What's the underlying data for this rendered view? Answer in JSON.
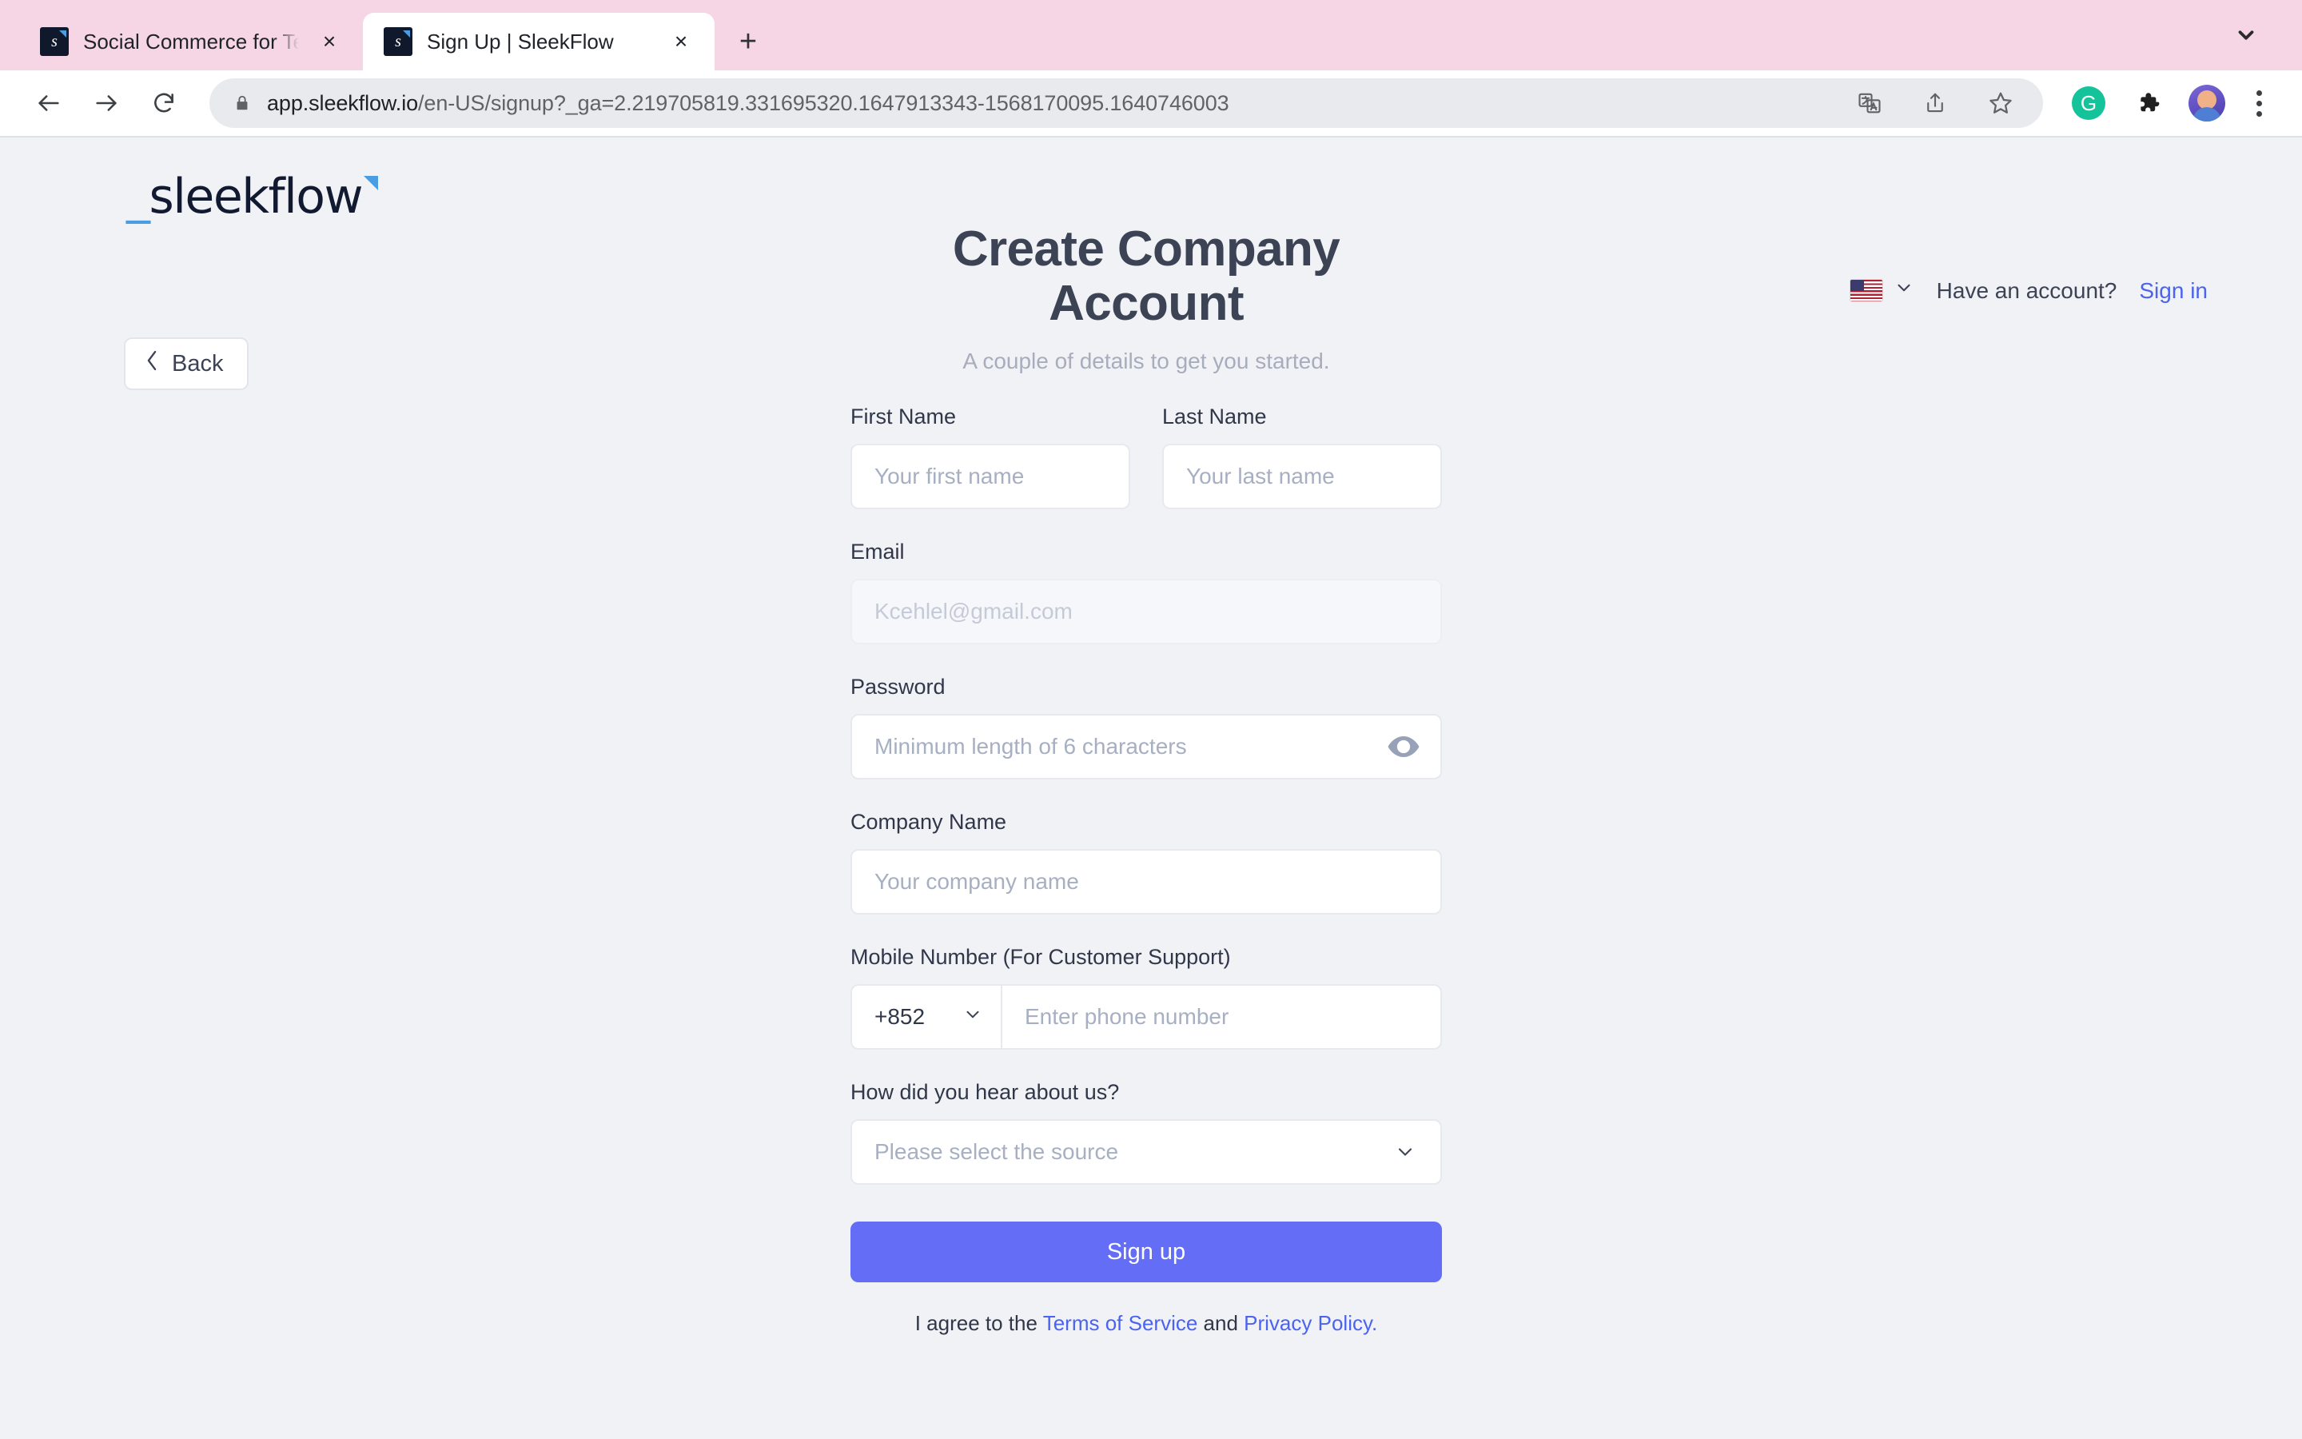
{
  "browser": {
    "tabs": [
      {
        "title": "Social Commerce for Teams | S",
        "favicon": "sleekflow-favicon",
        "active": false
      },
      {
        "title": "Sign Up | SleekFlow",
        "favicon": "sleekflow-favicon",
        "active": true
      }
    ],
    "new_tab_label": "+",
    "close_label": "×",
    "nav": {
      "back": "←",
      "forward": "→",
      "reload": "⟳"
    },
    "omnibox": {
      "url_bold": "app.sleekflow.io",
      "url_dim": "/en-US/signup?_ga=2.219705819.331695320.1647913343-1568170095.1640746003",
      "lock_icon": "lock-icon",
      "icons": [
        "translate-icon",
        "share-icon",
        "bookmark-star-icon"
      ]
    },
    "extensions": [
      "grammarly-icon",
      "puzzle-extensions-icon",
      "profile-avatar",
      "kebab-menu-icon"
    ],
    "grammarly_glyph": "G"
  },
  "page": {
    "logo": {
      "prefix": "_",
      "name": "sleekflow"
    },
    "back_button": {
      "label": "Back",
      "chevron": "‹"
    },
    "topbar": {
      "language_flag": "us-flag-icon",
      "account_prompt": "Have an account?",
      "signin_label": "Sign in"
    },
    "heading": "Create Company Account",
    "subheading": "A couple of details to get you started.",
    "fields": {
      "first_name": {
        "label": "First Name",
        "placeholder": "Your first name",
        "value": ""
      },
      "last_name": {
        "label": "Last Name",
        "placeholder": "Your last name",
        "value": ""
      },
      "email": {
        "label": "Email",
        "placeholder": "Kcehlel@gmail.com",
        "value": "",
        "disabled": true
      },
      "password": {
        "label": "Password",
        "placeholder": "Minimum length of 6 characters",
        "value": "",
        "toggle_icon": "eye-icon"
      },
      "company_name": {
        "label": "Company Name",
        "placeholder": "Your company name",
        "value": ""
      },
      "mobile": {
        "label": "Mobile Number (For Customer Support)",
        "country_code": "+852",
        "placeholder": "Enter phone number",
        "value": ""
      },
      "source": {
        "label": "How did you hear about us?",
        "placeholder": "Please select the source",
        "value": ""
      }
    },
    "signup_button": "Sign up",
    "agreement": {
      "prefix": "I agree to the ",
      "terms_label": "Terms of Service",
      "middle": " and ",
      "privacy_label": "Privacy Policy."
    }
  },
  "colors": {
    "tabstrip_bg": "#f6d6e4",
    "page_bg": "#f1f2f6",
    "accent_button": "#636df5",
    "link": "#4a63f0",
    "brand_navy": "#121a31",
    "brand_blue": "#4a9de0"
  }
}
